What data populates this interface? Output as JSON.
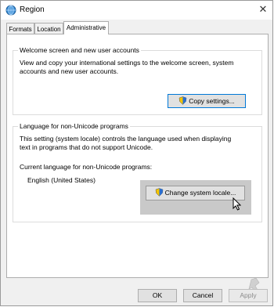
{
  "window": {
    "title": "Region",
    "close_glyph": "✕"
  },
  "tabs": [
    {
      "label": "Formats"
    },
    {
      "label": "Location"
    },
    {
      "label": "Administrative"
    }
  ],
  "welcome": {
    "title": "Welcome screen and new user accounts",
    "desc_line1": "View and copy your international settings to the welcome screen, system",
    "desc_line2": "accounts and new user accounts.",
    "copy_button": "Copy settings..."
  },
  "unicode": {
    "title": "Language for non-Unicode programs",
    "desc_line1": "This setting (system locale) controls the language used when displaying",
    "desc_line2": "text in programs that do not support Unicode.",
    "current_label": "Current language for non-Unicode programs:",
    "current_value": "English (United States)",
    "change_button": "Change system locale..."
  },
  "footer": {
    "ok": "OK",
    "cancel": "Cancel",
    "apply": "Apply"
  },
  "icons": {
    "app": "globe-clock-icon",
    "shield": "uac-shield-icon",
    "cursor": "mouse-pointer-icon"
  }
}
